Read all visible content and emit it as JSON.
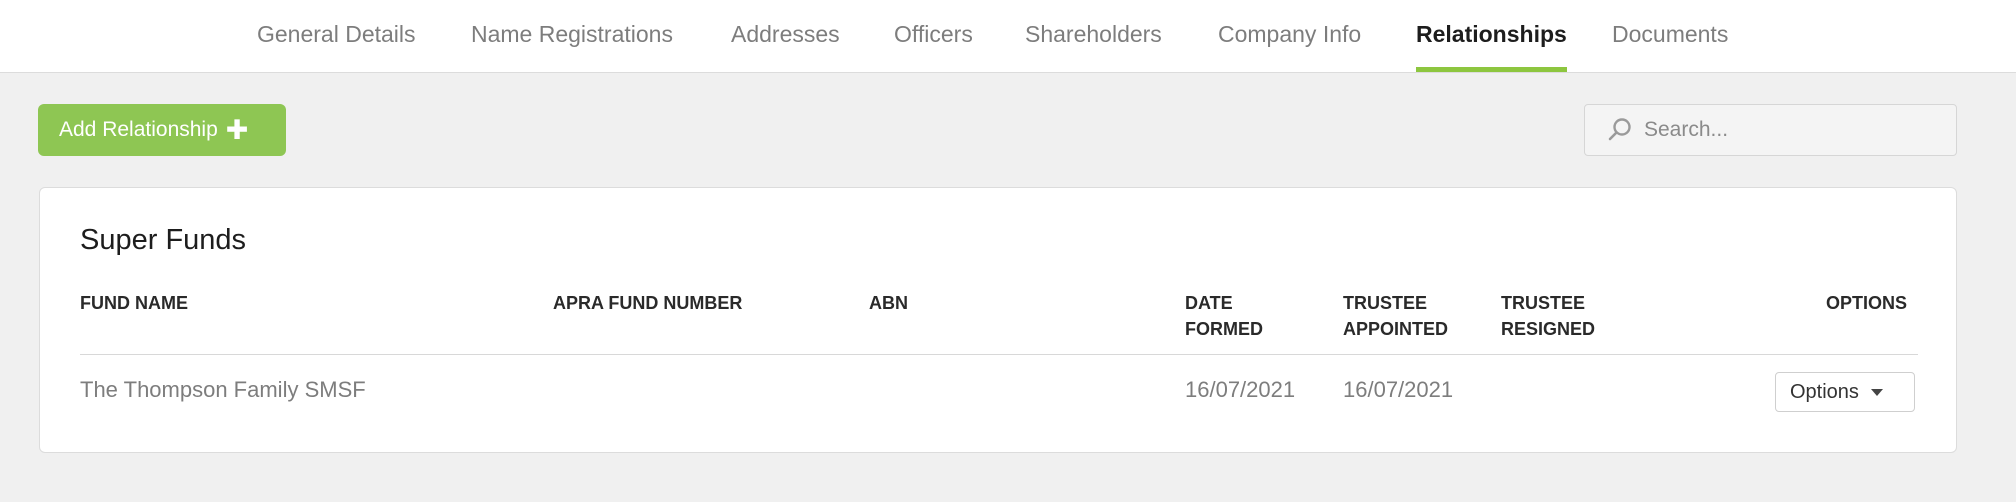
{
  "tabs": [
    {
      "label": "General Details"
    },
    {
      "label": "Name Registrations"
    },
    {
      "label": "Addresses"
    },
    {
      "label": "Officers"
    },
    {
      "label": "Shareholders"
    },
    {
      "label": "Company Info"
    },
    {
      "label": "Relationships",
      "active": true
    },
    {
      "label": "Documents"
    }
  ],
  "toolbar": {
    "add_label": "Add Relationship",
    "add_icon": "plus-icon",
    "search_placeholder": "Search..."
  },
  "colors": {
    "accent": "#8dc63f",
    "button": "#8ec653"
  },
  "panel": {
    "title": "Super Funds",
    "columns": {
      "fund_name": "FUND NAME",
      "apra_fund_number": "APRA FUND NUMBER",
      "abn": "ABN",
      "date_formed": [
        "DATE",
        "FORMED"
      ],
      "trustee_appointed": [
        "TRUSTEE",
        "APPOINTED"
      ],
      "trustee_resigned": [
        "TRUSTEE",
        "RESIGNED"
      ],
      "options": "OPTIONS"
    },
    "rows": [
      {
        "fund_name": "The Thompson Family SMSF",
        "apra_fund_number": "",
        "abn": "",
        "date_formed": "16/07/2021",
        "trustee_appointed": "16/07/2021",
        "trustee_resigned": "",
        "options_label": "Options"
      }
    ]
  }
}
